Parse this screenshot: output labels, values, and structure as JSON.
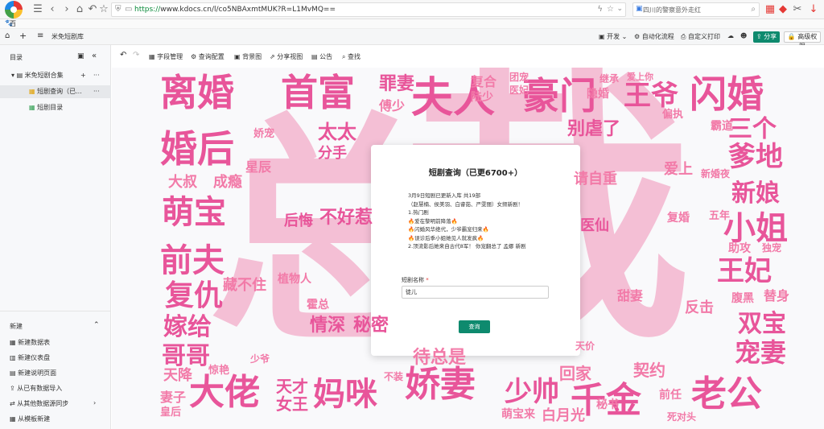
{
  "browser": {
    "url_scheme": "https://",
    "url_rest": "www.kdocs.cn/l/co5NBAxmtMUK?R=L1MvMQ==",
    "search_placeholder": "四川的警察意外走红",
    "bookmark": "百度"
  },
  "app": {
    "doc_title": "米免短剧库",
    "topbar": {
      "dev": "开发",
      "automation": "自动化流程",
      "custom_print": "自定义打印",
      "share": "分享",
      "permission": "高级权限"
    }
  },
  "sidebar": {
    "heading": "目录",
    "root": "米免短剧合集",
    "items": [
      "短剧查询（已...",
      "短剧目录"
    ],
    "new_section": "新建",
    "new_items": [
      "新建数据表",
      "新建仪表盘",
      "新建说明页面",
      "从已有数据导入",
      "从其他数据源同步",
      "从模板新建"
    ]
  },
  "toolbar": {
    "field_manage": "字段管理",
    "query_config": "查询配置",
    "background": "背景图",
    "share_view": "分享视图",
    "notice": "公告",
    "find": "查找"
  },
  "modal": {
    "title": "短剧查询（已更6700+）",
    "desc_lines": [
      "3月9日短剧已更新入库 共19部",
      "（赵慧楠、侯美羽、白睿茹、严雯丽）女频新剧！",
      "1.热门剧",
      "🔥爱在黎明前降落🔥",
      "🔥闪婚风华绝代，少爷霸宠归来🔥",
      "🔥误诊后季小姐她见人就发疯🔥",
      "2.顶流影后她来自古代8军！ 你宠翻总了 孟娜 新剧"
    ],
    "field_label": "短剧名称",
    "required_mark": "*",
    "field_value": "徒儿",
    "submit": "查询"
  },
  "cloud_words": [
    {
      "t": "离婚",
      "c": "#e8559a"
    },
    {
      "t": "首富",
      "c": "#e8559a"
    },
    {
      "t": "罪妻",
      "c": "#e8559a"
    },
    {
      "t": "傅少",
      "c": "#f27aa8"
    },
    {
      "t": "夫人",
      "c": "#e8559a"
    },
    {
      "t": "豪门",
      "c": "#e8559a"
    },
    {
      "t": "复合",
      "c": "#f27aa8"
    },
    {
      "t": "陆少",
      "c": "#f27aa8"
    },
    {
      "t": "团宠",
      "c": "#f27aa8"
    },
    {
      "t": "医妃",
      "c": "#f27aa8"
    },
    {
      "t": "继承",
      "c": "#f27aa8"
    },
    {
      "t": "爱上你",
      "c": "#f27aa8"
    },
    {
      "t": "王爷",
      "c": "#e8559a"
    },
    {
      "t": "隐婚",
      "c": "#f27aa8"
    },
    {
      "t": "闪婚",
      "c": "#e8559a"
    },
    {
      "t": "偏执",
      "c": "#f27aa8"
    },
    {
      "t": "别虐了",
      "c": "#e8559a"
    },
    {
      "t": "霸道",
      "c": "#f27aa8"
    },
    {
      "t": "三个",
      "c": "#e8559a"
    },
    {
      "t": "爹地",
      "c": "#e8559a"
    },
    {
      "t": "婚后",
      "c": "#e8559a"
    },
    {
      "t": "娇宠",
      "c": "#f27aa8"
    },
    {
      "t": "太太",
      "c": "#e8559a"
    },
    {
      "t": "分手",
      "c": "#e8559a"
    },
    {
      "t": "星辰",
      "c": "#f27aa8"
    },
    {
      "t": "大叔",
      "c": "#f27aa8"
    },
    {
      "t": "成瘾",
      "c": "#f27aa8"
    },
    {
      "t": "萌宝",
      "c": "#e8559a"
    },
    {
      "t": "爱上",
      "c": "#f27aa8"
    },
    {
      "t": "新婚夜",
      "c": "#f27aa8"
    },
    {
      "t": "新娘",
      "c": "#e8559a"
    },
    {
      "t": "请自重",
      "c": "#f27aa8"
    },
    {
      "t": "后悔",
      "c": "#e8559a"
    },
    {
      "t": "不好惹",
      "c": "#e8559a"
    },
    {
      "t": "小姐",
      "c": "#e8559a"
    },
    {
      "t": "复婚",
      "c": "#f27aa8"
    },
    {
      "t": "五年",
      "c": "#f27aa8"
    },
    {
      "t": "医仙",
      "c": "#e8559a"
    },
    {
      "t": "前夫",
      "c": "#e8559a"
    },
    {
      "t": "助攻",
      "c": "#f27aa8"
    },
    {
      "t": "独宠",
      "c": "#f27aa8"
    },
    {
      "t": "王妃",
      "c": "#e8559a"
    },
    {
      "t": "复仇",
      "c": "#e8559a"
    },
    {
      "t": "藏不住",
      "c": "#f27aa8"
    },
    {
      "t": "植物人",
      "c": "#f27aa8"
    },
    {
      "t": "甜妻",
      "c": "#f27aa8"
    },
    {
      "t": "反击",
      "c": "#f27aa8"
    },
    {
      "t": "腹黑",
      "c": "#f27aa8"
    },
    {
      "t": "替身",
      "c": "#f27aa8"
    },
    {
      "t": "霍总",
      "c": "#f27aa8"
    },
    {
      "t": "情深",
      "c": "#e8559a"
    },
    {
      "t": "秘密",
      "c": "#e8559a"
    },
    {
      "t": "嫁给",
      "c": "#e8559a"
    },
    {
      "t": "双宝",
      "c": "#e8559a"
    },
    {
      "t": "哥哥",
      "c": "#e8559a"
    },
    {
      "t": "宠妻",
      "c": "#e8559a"
    },
    {
      "t": "少爷",
      "c": "#f27aa8"
    },
    {
      "t": "待总是",
      "c": "#f27aa8"
    },
    {
      "t": "天价",
      "c": "#f27aa8"
    },
    {
      "t": "天降",
      "c": "#f27aa8"
    },
    {
      "t": "惊艳",
      "c": "#f27aa8"
    },
    {
      "t": "大佬",
      "c": "#e8559a"
    },
    {
      "t": "天才",
      "c": "#e8559a"
    },
    {
      "t": "女王",
      "c": "#e8559a"
    },
    {
      "t": "妈咪",
      "c": "#e8559a"
    },
    {
      "t": "不装",
      "c": "#f27aa8"
    },
    {
      "t": "娇妻",
      "c": "#e8559a"
    },
    {
      "t": "少帅",
      "c": "#e8559a"
    },
    {
      "t": "回家",
      "c": "#f27aa8"
    },
    {
      "t": "契约",
      "c": "#f27aa8"
    },
    {
      "t": "千金",
      "c": "#e8559a"
    },
    {
      "t": "老公",
      "c": "#e8559a"
    },
    {
      "t": "妻子",
      "c": "#f27aa8"
    },
    {
      "t": "皇后",
      "c": "#f27aa8"
    },
    {
      "t": "萌宝来",
      "c": "#f27aa8"
    },
    {
      "t": "白月光",
      "c": "#f27aa8"
    },
    {
      "t": "秘书",
      "c": "#f27aa8"
    },
    {
      "t": "前任",
      "c": "#f27aa8"
    },
    {
      "t": "死对头",
      "c": "#f27aa8"
    },
    {
      "t": "总",
      "c": "#f07aa8"
    },
    {
      "t": "裁",
      "c": "#f07aa8"
    }
  ]
}
